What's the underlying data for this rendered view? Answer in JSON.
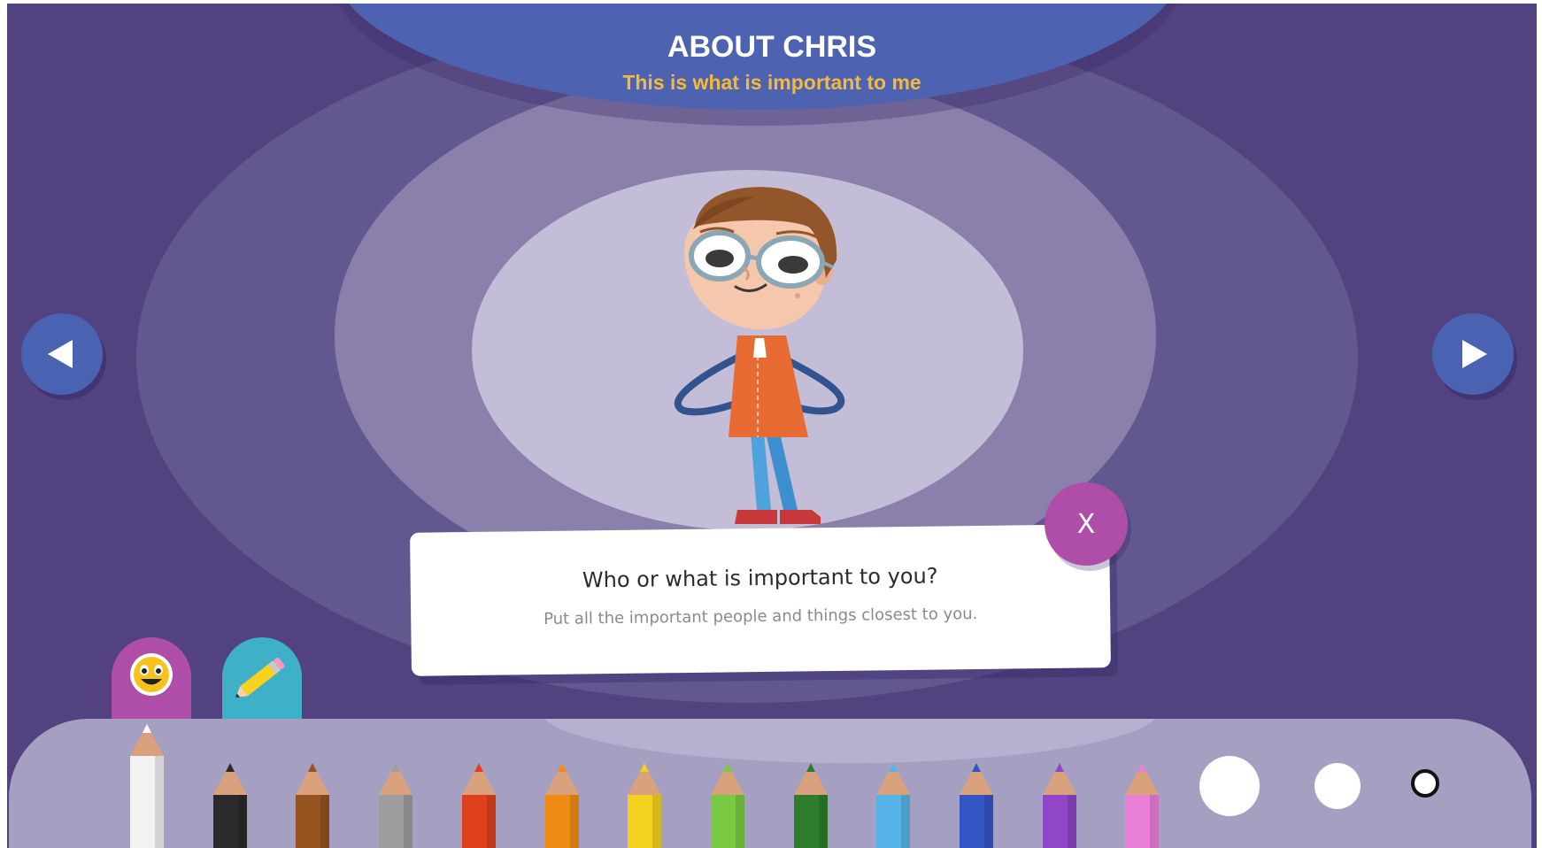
{
  "header": {
    "title": "ABOUT CHRIS",
    "subtitle": "This is what is important to me"
  },
  "card": {
    "question": "Who or what is important to you?",
    "hint": "Put all the important people and things closest to you.",
    "close_label": "X"
  },
  "nav": {
    "prev_icon": "triangle-left-icon",
    "next_icon": "triangle-right-icon"
  },
  "tabs": [
    {
      "icon": "smiley-face-icon",
      "color": "#ae4ea8"
    },
    {
      "icon": "pencil-icon",
      "color": "#3eb1c8"
    }
  ],
  "pencils": [
    {
      "color": "#f2f2f2",
      "name": "white",
      "selected": true
    },
    {
      "color": "#2a2a2a",
      "name": "black"
    },
    {
      "color": "#94531f",
      "name": "brown"
    },
    {
      "color": "#9e9e9e",
      "name": "grey"
    },
    {
      "color": "#e0401e",
      "name": "red"
    },
    {
      "color": "#ef8a12",
      "name": "orange"
    },
    {
      "color": "#f4d01f",
      "name": "yellow"
    },
    {
      "color": "#7ac943",
      "name": "light-green"
    },
    {
      "color": "#2e7d2c",
      "name": "dark-green"
    },
    {
      "color": "#56b4e9",
      "name": "light-blue"
    },
    {
      "color": "#3456c4",
      "name": "blue"
    },
    {
      "color": "#9046c8",
      "name": "purple"
    },
    {
      "color": "#ea7fd6",
      "name": "pink"
    }
  ],
  "brush_sizes": [
    "large",
    "medium",
    "small"
  ],
  "brush_selected": "small",
  "colors": {
    "background": "#52427f",
    "header": "#4d63b1",
    "subtitle": "#f5b93a",
    "accent": "#ae4ea8",
    "toolbar": "#a59fc2"
  }
}
